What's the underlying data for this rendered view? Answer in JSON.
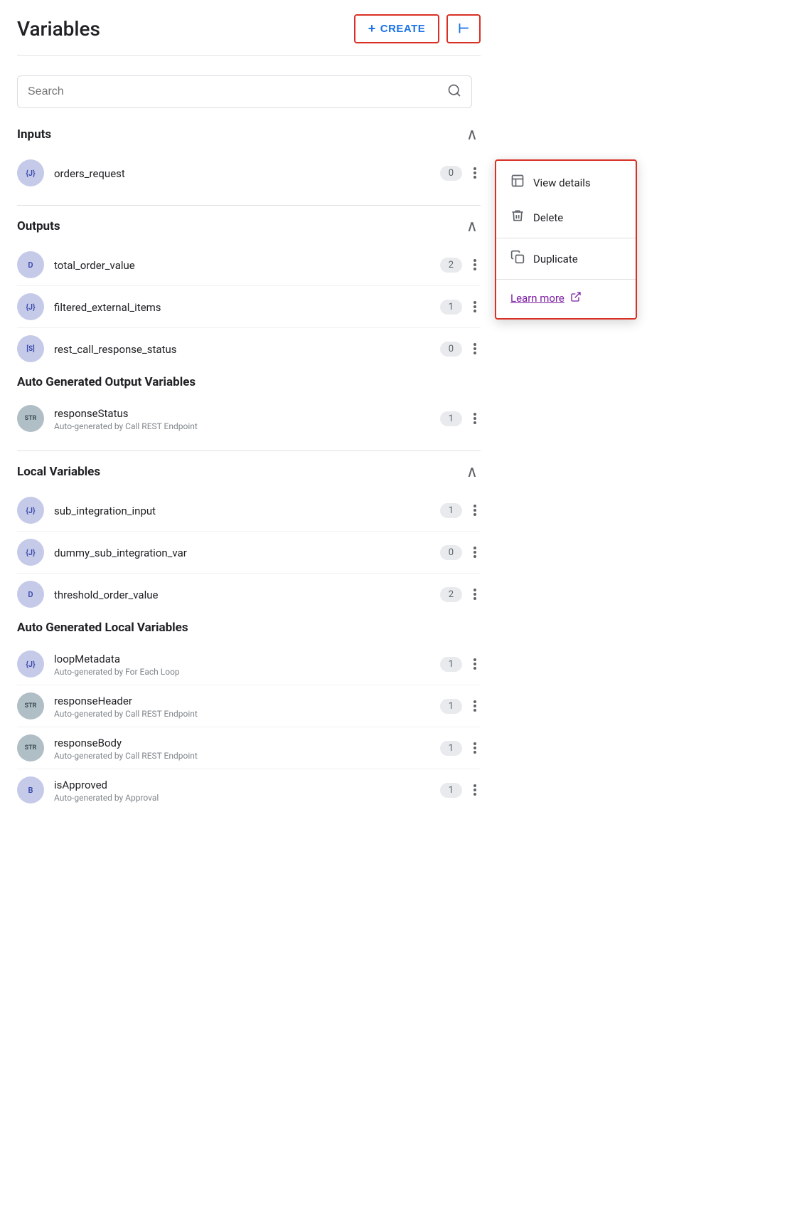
{
  "header": {
    "title": "Variables",
    "create_label": "CREATE",
    "create_plus": "+",
    "collapse_icon": "⊣"
  },
  "search": {
    "placeholder": "Search"
  },
  "sections": {
    "inputs": {
      "title": "Inputs",
      "items": [
        {
          "id": "orders_request",
          "name": "orders_request",
          "icon": "{J}",
          "badge": "0",
          "has_menu": true,
          "show_context": true
        }
      ]
    },
    "outputs": {
      "title": "Outputs",
      "items": [
        {
          "id": "total_order_value",
          "name": "total_order_value",
          "icon": "D",
          "badge": "2",
          "has_menu": true
        },
        {
          "id": "filtered_external_items",
          "name": "filtered_external_items",
          "icon": "{J}",
          "badge": "1",
          "has_menu": true
        },
        {
          "id": "rest_call_response_status",
          "name": "rest_call_response_status",
          "icon": "S",
          "badge": "0",
          "has_menu": true
        }
      ]
    },
    "auto_output": {
      "title": "Auto Generated Output Variables",
      "items": [
        {
          "id": "responseStatus",
          "name": "responseStatus",
          "subtext": "Auto-generated by Call REST Endpoint",
          "icon": "STR",
          "badge": "1",
          "has_menu": true
        }
      ]
    },
    "local_variables": {
      "title": "Local Variables",
      "items": [
        {
          "id": "sub_integration_input",
          "name": "sub_integration_input",
          "icon": "{J}",
          "badge": "1",
          "has_menu": true
        },
        {
          "id": "dummy_sub_integration_var",
          "name": "dummy_sub_integration_var",
          "icon": "{J}",
          "badge": "0",
          "has_menu": true
        },
        {
          "id": "threshold_order_value",
          "name": "threshold_order_value",
          "icon": "D",
          "badge": "2",
          "has_menu": true
        }
      ]
    },
    "auto_local": {
      "title": "Auto Generated Local Variables",
      "items": [
        {
          "id": "loopMetadata",
          "name": "loopMetadata",
          "subtext": "Auto-generated by For Each Loop",
          "icon": "{J}",
          "badge": "1",
          "has_menu": true
        },
        {
          "id": "responseHeader",
          "name": "responseHeader",
          "subtext": "Auto-generated by Call REST Endpoint",
          "icon": "STR",
          "badge": "1",
          "has_menu": true
        },
        {
          "id": "responseBody",
          "name": "responseBody",
          "subtext": "Auto-generated by Call REST Endpoint",
          "icon": "STR",
          "badge": "1",
          "has_menu": true
        },
        {
          "id": "isApproved",
          "name": "isApproved",
          "subtext": "Auto-generated by Approval",
          "icon": "B",
          "badge": "1",
          "has_menu": true
        }
      ]
    }
  },
  "context_menu": {
    "view_details": "View details",
    "delete": "Delete",
    "duplicate": "Duplicate",
    "learn_more": "Learn more"
  }
}
